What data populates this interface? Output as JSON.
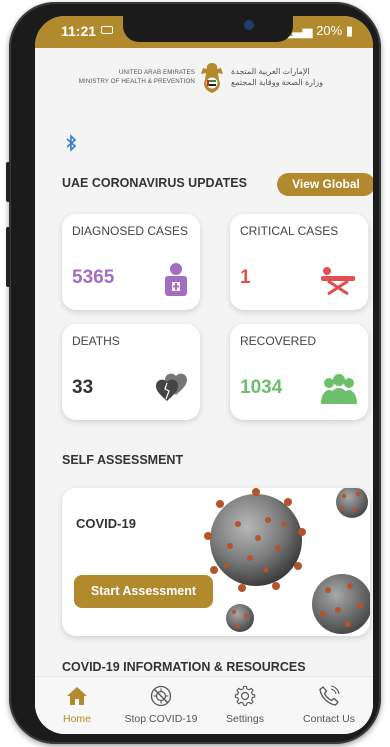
{
  "statusbar": {
    "time": "11:21",
    "battery": "20%"
  },
  "header": {
    "org_en_line1": "UNITED ARAB EMIRATES",
    "org_en_line2": "MINISTRY OF HEALTH & PREVENTION",
    "org_ar_line1": "الإمارات العربية المتحدة",
    "org_ar_line2": "وزارة الصحة ووقاية المجتمع"
  },
  "updates": {
    "title": "UAE CORONAVIRUS UPDATES",
    "view_global_label": "View Global",
    "cards": [
      {
        "label": "DIAGNOSED CASES",
        "value": "5365",
        "color": "#a56dc2",
        "icon": "patient-icon"
      },
      {
        "label": "CRITICAL CASES",
        "value": "1",
        "color": "#e0504d",
        "icon": "stretcher-icon"
      },
      {
        "label": "DEATHS",
        "value": "33",
        "color": "#333333",
        "icon": "broken-hearts-icon"
      },
      {
        "label": "RECOVERED",
        "value": "1034",
        "color": "#6cc06c",
        "icon": "people-group-icon"
      }
    ]
  },
  "self_assessment": {
    "title": "SELF ASSESSMENT",
    "card_title": "COVID-19",
    "button_label": "Start Assessment"
  },
  "resources": {
    "title": "COVID-19 INFORMATION & RESOURCES"
  },
  "nav": {
    "items": [
      {
        "label": "Home",
        "icon": "home-icon",
        "active": true
      },
      {
        "label": "Stop COVID-19",
        "icon": "virus-stop-icon",
        "active": false
      },
      {
        "label": "Settings",
        "icon": "gear-icon",
        "active": false
      },
      {
        "label": "Contact Us",
        "icon": "phone-icon",
        "active": false
      }
    ]
  },
  "colors": {
    "accent": "#b28a2e"
  }
}
